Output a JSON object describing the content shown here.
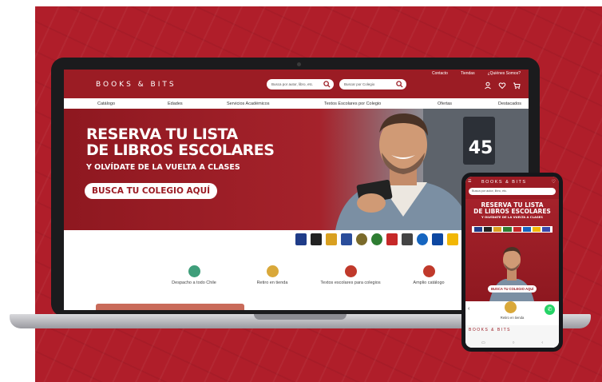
{
  "desktop": {
    "top_links": [
      "Contacto",
      "Tiendas",
      "¿Quiénes Somos?"
    ],
    "logo": "BOOKS & BITS",
    "search_book_placeholder": "Busca por autor, libro, etc.",
    "search_school_placeholder": "Buscar por Colegio",
    "nav": [
      "Catálogo",
      "Edades",
      "Servicios Académicos",
      "Textos Escolares por Colegio",
      "Ofertas",
      "Destacados"
    ],
    "hero": {
      "line1": "RESERVA TU LISTA",
      "line2": "DE LIBROS ESCOLARES",
      "line3": "Y OLVÍDATE DE LA VUELTA A CLASES",
      "cta": "BUSCA TU COLEGIO AQUÍ",
      "door_number": "45"
    },
    "features": [
      {
        "label": "Despacho a todo Chile",
        "color": "#3f9e7a"
      },
      {
        "label": "Retiro en tienda",
        "color": "#d9a83a"
      },
      {
        "label": "Textos escolares para colegios",
        "color": "#c0392b"
      },
      {
        "label": "Amplio catálogo",
        "color": "#c0392b"
      }
    ]
  },
  "mobile": {
    "logo": "BOOKS & BITS",
    "search_placeholder": "Busca por autor, libro, etc.",
    "hero": {
      "line1": "RESERVA TU LISTA",
      "line2": "DE LIBROS ESCOLARES",
      "line3": "Y OLVÍDATE DE LA VUELTA A CLASES",
      "cta": "BUSCA TU COLEGIO AQUÍ"
    },
    "feature_label": "Retiro en tienda",
    "footer_logo": "BOOKS & BITS"
  },
  "colors": {
    "brand": "#9b1c24",
    "background": "#b01e2a",
    "whatsapp": "#25d366"
  }
}
